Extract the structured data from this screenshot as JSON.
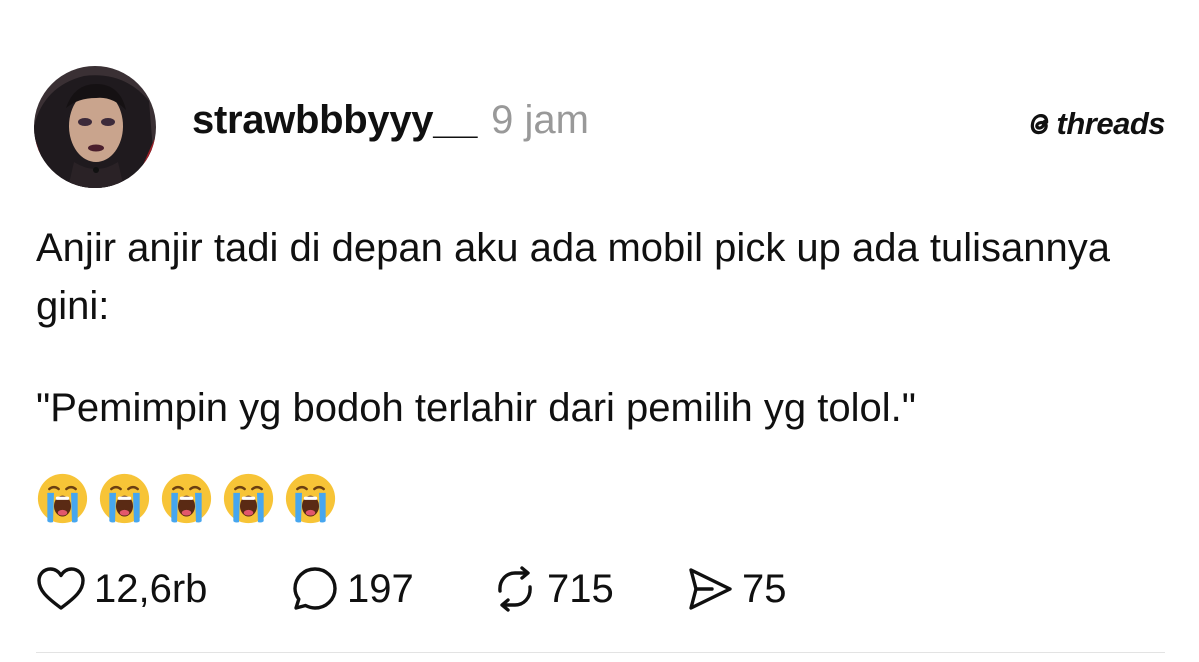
{
  "post": {
    "username": "strawbbbyyy__",
    "time": "9 jam",
    "text_line1": "Anjir anjir tadi di depan aku ada mobil pick up ada tulisannya gini:",
    "text_line2": "\"Pemimpin yg bodoh terlahir dari pemilih yg tolol.\"",
    "emojis": [
      "loudly-crying-face",
      "loudly-crying-face",
      "loudly-crying-face",
      "loudly-crying-face",
      "loudly-crying-face"
    ]
  },
  "brand": {
    "label": "threads",
    "icon": "threads-logo-icon"
  },
  "actions": {
    "likes": "12,6rb",
    "replies": "197",
    "reposts": "715",
    "shares": "75"
  },
  "icons": {
    "like": "heart-icon",
    "reply": "comment-bubble-icon",
    "repost": "repost-arrows-icon",
    "share": "send-icon"
  },
  "colors": {
    "text": "#101010",
    "muted": "#999999",
    "background": "#ffffff",
    "divider": "#e3e3e3"
  }
}
